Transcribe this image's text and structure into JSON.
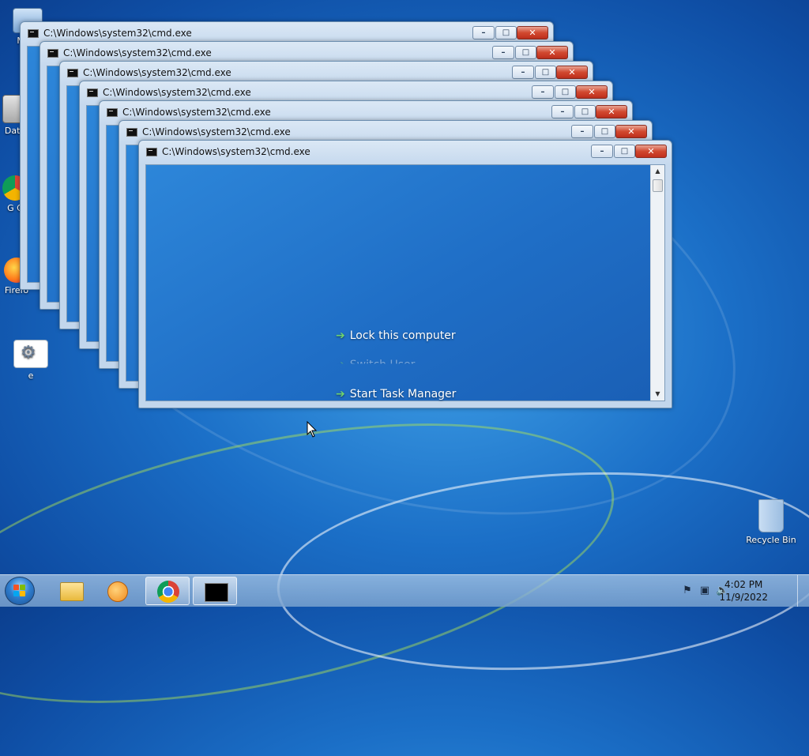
{
  "desktop": {
    "icons": [
      {
        "label": "My C",
        "icon": "computer-icon"
      },
      {
        "label": "Data",
        "icon": "shortcut-icon"
      },
      {
        "label": "G C",
        "icon": "chrome-icon"
      },
      {
        "label": "Firefo",
        "icon": "firefox-icon"
      },
      {
        "label": "e",
        "icon": "settings-app-icon"
      },
      {
        "label": "Recycle Bin",
        "icon": "recycle-bin-icon"
      }
    ],
    "overlay": {
      "lock": "Lock this computer",
      "switch_user": "Switch User",
      "task_manager": "Start Task Manager"
    }
  },
  "windows": [
    {
      "title": "C:\\Windows\\system32\\cmd.exe"
    },
    {
      "title": "C:\\Windows\\system32\\cmd.exe"
    },
    {
      "title": "C:\\Windows\\system32\\cmd.exe"
    },
    {
      "title": "C:\\Windows\\system32\\cmd.exe"
    },
    {
      "title": "C:\\Windows\\system32\\cmd.exe"
    },
    {
      "title": "C:\\Windows\\system32\\cmd.exe"
    },
    {
      "title": "C:\\Windows\\system32\\cmd.exe"
    }
  ],
  "window_controls": {
    "minimize": "–",
    "maximize": "□",
    "close": "✕"
  },
  "taskbar": {
    "items": [
      {
        "name": "file-explorer",
        "icon": "folder-icon"
      },
      {
        "name": "media-player",
        "icon": "media-player-icon"
      },
      {
        "name": "chrome",
        "icon": "chrome-icon"
      },
      {
        "name": "cmd",
        "icon": "cmd-icon"
      }
    ],
    "clock": {
      "time": "4:02 PM",
      "date": "11/9/2022"
    }
  },
  "colors": {
    "accent": "#1b6fc7",
    "close": "#c0301d"
  }
}
